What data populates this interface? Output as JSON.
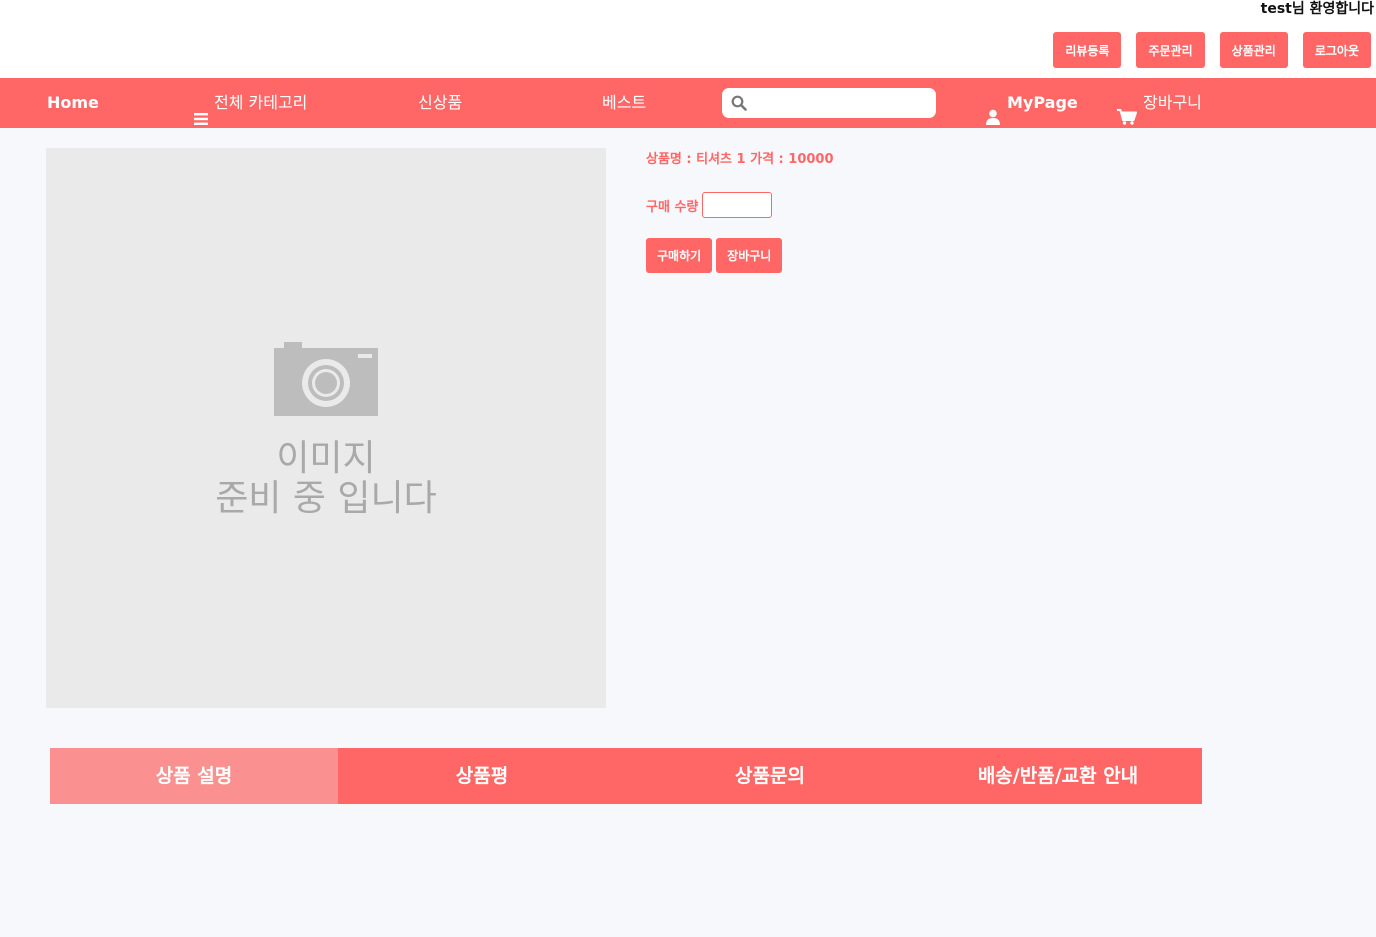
{
  "header": {
    "welcome_user": "test",
    "welcome_suffix": "님 환영합니다",
    "actions": [
      "리뷰등록",
      "주문관리",
      "상품관리",
      "로그아웃"
    ]
  },
  "nav": {
    "home": "Home",
    "categories": "전체 카테고리",
    "new": "신상품",
    "best": "베스트",
    "search_placeholder": "",
    "mypage": "MyPage",
    "cart": "장바구니"
  },
  "product": {
    "image_text_line1": "이미지",
    "image_text_line2": "준비 중 입니다",
    "info": "상품명 : 티셔츠 1 가격 : 10000",
    "qty_label": "구매 수량",
    "qty_value": "",
    "buy_label": "구매하기",
    "cart_label": "장바구니"
  },
  "tabs": [
    "상품 설명",
    "상품평",
    "상품문의",
    "배송/반품/교환 안내"
  ],
  "colors": {
    "accent": "#ff6767",
    "active_tab": "#fa9090",
    "background": "#f6f8fb",
    "image_placeholder": "#eaeaea"
  }
}
